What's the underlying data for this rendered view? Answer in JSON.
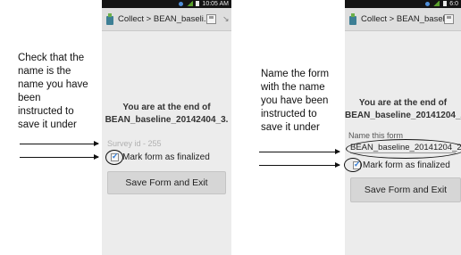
{
  "left": {
    "note": "Check that the\nname is the\nname you have\nbeen\ninstructed to\nsave it under",
    "status_time": "10:05 AM",
    "title": "Collect > BEAN_baseli...",
    "end_line1": "You are at the end of",
    "end_line2": "BEAN_baseline_20142404_3.",
    "survey_label": "Survey id - 255",
    "checkbox_label": "Mark form as finalized",
    "button_label": "Save Form and Exit"
  },
  "right": {
    "note": "Name the form\nwith the name\nyou have been\ninstructed to\nsave it under",
    "status_time": "6:0",
    "title": "Collect > BEAN_baseli...",
    "end_line1": "You are at the end of",
    "end_line2": "BEAN_baseline_20141204_2.",
    "name_label": "Name this form",
    "name_value": "BEAN_baseline_20141204_2",
    "checkbox_label": "Mark form as finalized",
    "button_label": "Save Form and Exit"
  },
  "colors": {
    "status_bar": "#141414",
    "action_bar": "#dedede",
    "screen": "#ececec",
    "checkmark": "#2f7ad6"
  }
}
